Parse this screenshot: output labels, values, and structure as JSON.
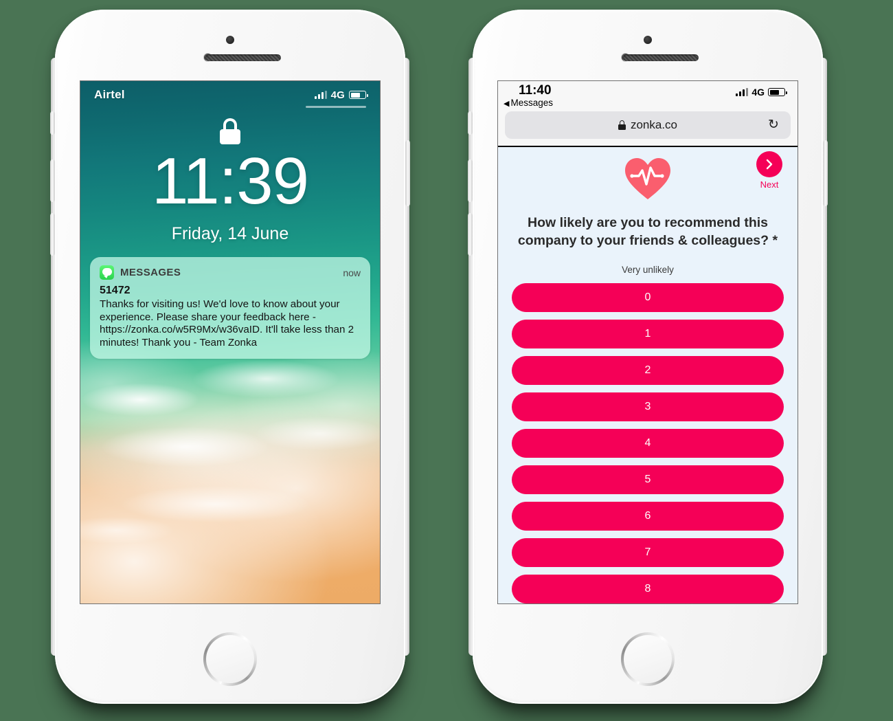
{
  "background_color": "#4a7454",
  "accent_pink": "#f50057",
  "survey_bg": "#eaf3fb",
  "phone_left": {
    "name": "lock-screen-phone",
    "status_bar": {
      "carrier": "Airtel",
      "network": "4G",
      "signal_icon": "signal-bars-icon",
      "battery_icon": "battery-icon"
    },
    "lock_icon": "lock-icon",
    "time": "11:39",
    "date": "Friday, 14 June",
    "notification": {
      "app_icon": "messages-app-icon",
      "app_name": "MESSAGES",
      "timestamp": "now",
      "sender": "51472",
      "body": "Thanks for visiting us! We'd love to know about your experience. Please share your feedback here - https://zonka.co/w5R9Mx/w36vaID. It'll take less than 2 minutes! Thank you - Team Zonka"
    }
  },
  "phone_right": {
    "name": "safari-survey-phone",
    "status_bar": {
      "time": "11:40",
      "back_label": "Messages",
      "back_icon": "triangle-left-icon",
      "network": "4G",
      "signal_icon": "signal-bars-icon",
      "battery_icon": "battery-icon"
    },
    "browser": {
      "lock_icon": "padlock-icon",
      "url": "zonka.co",
      "reload_icon": "reload-icon"
    },
    "survey": {
      "logo_icon": "heart-pulse-icon",
      "next_icon": "chevron-right-icon",
      "next_label": "Next",
      "question": "How likely are you to recommend this company to your friends & colleagues? *",
      "low_anchor": "Very unlikely",
      "scale_options": [
        "0",
        "1",
        "2",
        "3",
        "4",
        "5",
        "6",
        "7",
        "8"
      ]
    }
  }
}
